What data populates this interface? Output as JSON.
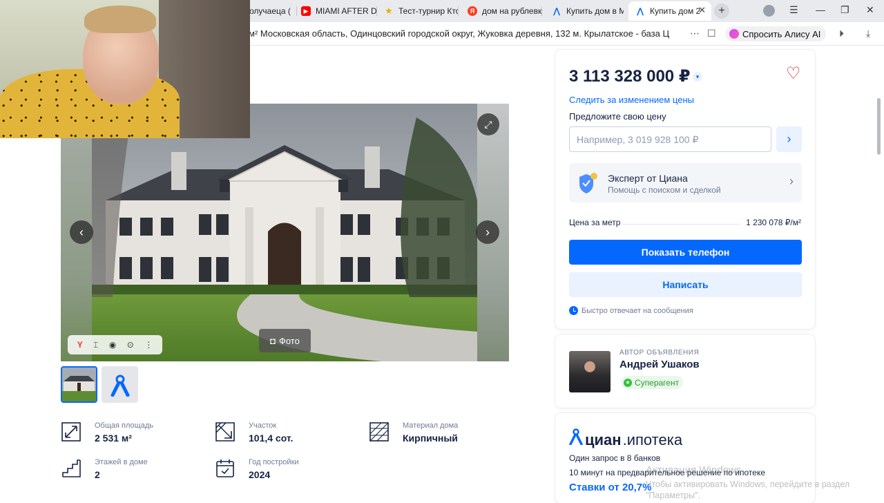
{
  "browser": {
    "tabs": [
      {
        "label": "олучаеца (",
        "favicon": "page-icon",
        "color": "#8a8f99"
      },
      {
        "label": "MIAMI AFTER DA",
        "favicon": "youtube-icon",
        "color": "#ff0000"
      },
      {
        "label": "Тест-турнир Кто",
        "favicon": "star-icon",
        "color": "#f1c40f"
      },
      {
        "label": "дом на рублевк",
        "favicon": "yandex-icon",
        "color": "#fc3f1d"
      },
      {
        "label": "Купить дом в Мо",
        "favicon": "cian-icon",
        "color": "#0468ff"
      },
      {
        "label": "Купить дом 2",
        "favicon": "cian-icon",
        "color": "#0468ff",
        "active": true
      }
    ],
    "address": "м² Московская область, Одинцовский городской округ, Жуковка деревня, 132 м. Крылатское - база ЦИ...",
    "alice_label": "Спросить Алису AI"
  },
  "gallery": {
    "photo_button_label": "Фото"
  },
  "facts": [
    {
      "label": "Общая площадь",
      "value": "2 531 м²",
      "icon": "area-icon"
    },
    {
      "label": "Участок",
      "value": "101,4 сот.",
      "icon": "plot-icon"
    },
    {
      "label": "Материал дома",
      "value": "Кирпичный",
      "icon": "brick-icon"
    },
    {
      "label": "Этажей в доме",
      "value": "2",
      "icon": "stairs-icon"
    },
    {
      "label": "Год постройки",
      "value": "2024",
      "icon": "calendar-icon"
    }
  ],
  "price_card": {
    "price": "3 113 328 000 ₽",
    "follow_price": "Следить за изменением цены",
    "offer_label": "Предложите свою цену",
    "offer_placeholder": "Например, 3 019 928 100 ₽",
    "expert_title": "Эксперт от Циана",
    "expert_subtitle": "Помощь с поиском и сделкой",
    "price_per_meter_label": "Цена за метр",
    "price_per_meter_value": "1 230 078 ₽/м²",
    "show_phone": "Показать телефон",
    "write": "Написать",
    "fast_reply": "Быстро отвечает на сообщения"
  },
  "author": {
    "label": "АВТОР ОБЪЯВЛЕНИЯ",
    "name": "Андрей Ушаков",
    "badge": "Суперагент"
  },
  "mortgage": {
    "logo_word1": "циан",
    "logo_word2": ".ипотека",
    "line1": "Один запрос в 8 банков",
    "line2": "10 минут на предварительное решение по ипотеке",
    "rate": "Ставки от 20,7%"
  },
  "watermark": {
    "line1": "Активация Windows",
    "line2": "Чтобы активировать Windows, перейдите в раздел",
    "line3": "\"Параметры\"."
  },
  "colors": {
    "accent": "#0468ff",
    "text": "#152242",
    "heart": "#c4203c"
  }
}
